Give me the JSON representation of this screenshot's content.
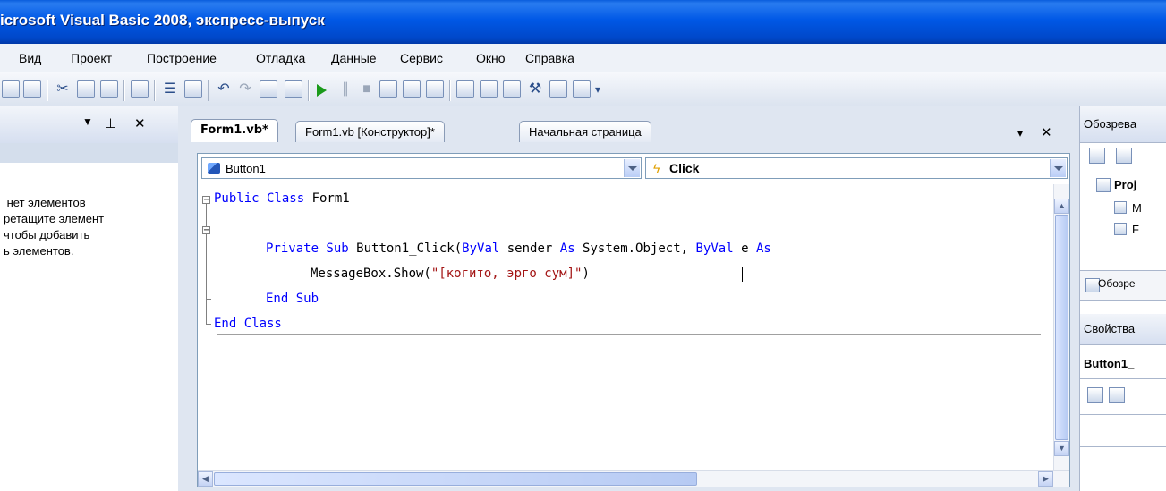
{
  "window": {
    "title": "icrosoft Visual Basic 2008, экспресс-выпуск"
  },
  "menu": [
    "Вид",
    "Проект",
    "Построение",
    "Отладка",
    "Данные",
    "Сервис",
    "Окно",
    "Справка"
  ],
  "toolbox": {
    "pin_glyph": "▾ ⊥ ✕",
    "empty_message": " нет элементов\nретащите элемент\nчтобы добавить\nь элементов."
  },
  "tabs": [
    {
      "label": "Form1.vb*",
      "active": true
    },
    {
      "label": "Form1.vb [Конструктор]*",
      "active": false
    },
    {
      "label": "Начальная страница",
      "active": false
    }
  ],
  "doc_controls": {
    "dropdown": "▾",
    "close": "✕"
  },
  "editor": {
    "object_combo": "Button1",
    "event_combo": "Click",
    "code": {
      "l1_kw": "Public Class ",
      "l1_name": "Form1",
      "l2_kw1": "Private Sub ",
      "l2_name": "Button1_Click(",
      "l2_kw2": "ByVal",
      "l2_a": " sender ",
      "l2_kw3": "As",
      "l2_b": " System.Object, ",
      "l2_kw4": "ByVal",
      "l2_c": " e ",
      "l2_kw5": "As",
      "l3_a": "MessageBox.Show(",
      "l3_str": "\"[когито, эрго сум]\"",
      "l3_b": ")",
      "l4_kw": "End Sub",
      "l5_kw": "End Class"
    }
  },
  "right_panel": {
    "solution_explorer_title": "Обозрева",
    "project_node": "Proj",
    "tree_item_1": "M",
    "tree_item_2": "F",
    "explorer_tab": "Обозре",
    "properties_title": "Свойства",
    "properties_object": "Button1_"
  },
  "colors": {
    "keyword": "#0000ff",
    "string": "#a31515",
    "titlebar": "#0058e6"
  }
}
